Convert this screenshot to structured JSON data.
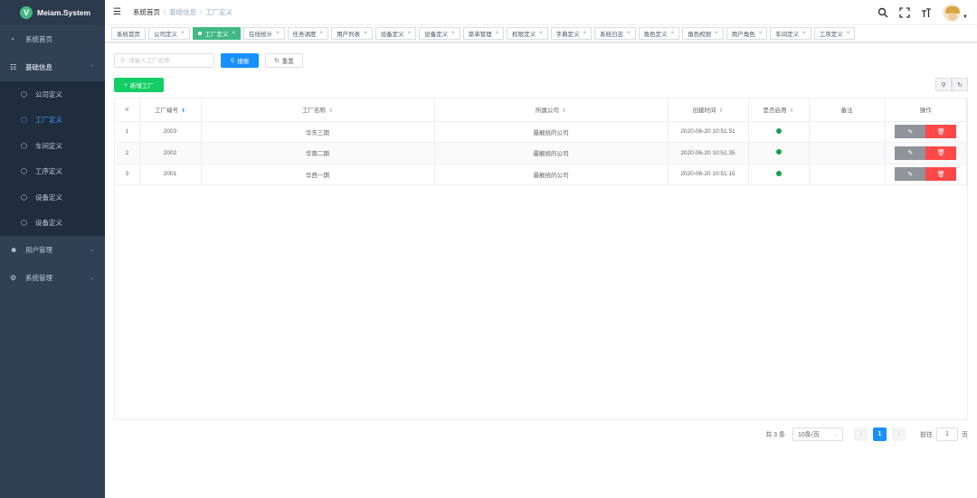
{
  "app": {
    "logo_letter": "V",
    "title": "Meiam.System"
  },
  "sidebar": {
    "items": [
      {
        "label": "系统首页",
        "icon": "dashboard-icon"
      },
      {
        "label": "基础信息",
        "icon": "sitemap-icon",
        "open": true
      },
      {
        "label": "用户管理",
        "icon": "user-group-icon"
      },
      {
        "label": "系统管理",
        "icon": "gear-icon"
      }
    ],
    "sub_items": [
      {
        "label": "公司定义"
      },
      {
        "label": "工厂定义",
        "active": true
      },
      {
        "label": "车间定义"
      },
      {
        "label": "工序定义"
      },
      {
        "label": "设备定义"
      },
      {
        "label": "设备定义"
      }
    ]
  },
  "breadcrumb": [
    "系统首页",
    "基础信息",
    "工厂定义"
  ],
  "tags": [
    {
      "label": "系统首页",
      "closable": false
    },
    {
      "label": "公司定义",
      "closable": true
    },
    {
      "label": "工厂定义",
      "closable": true,
      "active": true
    },
    {
      "label": "在线统计",
      "closable": true
    },
    {
      "label": "任务调度",
      "closable": true
    },
    {
      "label": "用户列表",
      "closable": true
    },
    {
      "label": "设备定义",
      "closable": true
    },
    {
      "label": "设备定义",
      "closable": true
    },
    {
      "label": "菜单管理",
      "closable": true
    },
    {
      "label": "权限定义",
      "closable": true
    },
    {
      "label": "字典定义",
      "closable": true
    },
    {
      "label": "系统日志",
      "closable": true
    },
    {
      "label": "角色定义",
      "closable": true
    },
    {
      "label": "角色权限",
      "closable": true
    },
    {
      "label": "用户角色",
      "closable": true
    },
    {
      "label": "车间定义",
      "closable": true
    },
    {
      "label": "工序定义",
      "closable": true
    }
  ],
  "search": {
    "placeholder": "请输入工厂名称",
    "search_label": "搜索",
    "reset_label": "重置"
  },
  "add_button": "新增工厂",
  "table": {
    "columns": [
      "#",
      "工厂编号",
      "工厂名称",
      "所属公司",
      "创建时间",
      "是否启用",
      "备注",
      "操作"
    ],
    "rows": [
      {
        "idx": "1",
        "code": "2003",
        "name": "华东三期",
        "company": "最靓统的公司",
        "created": "2020-06-20 10:51:51",
        "enabled": true,
        "remark": ""
      },
      {
        "idx": "2",
        "code": "2002",
        "name": "华南二期",
        "company": "最靓统的公司",
        "created": "2020-06-20 10:51:35",
        "enabled": true,
        "remark": ""
      },
      {
        "idx": "3",
        "code": "2001",
        "name": "华西一期",
        "company": "最靓统的公司",
        "created": "2020-06-20 10:51:15",
        "enabled": true,
        "remark": ""
      }
    ]
  },
  "pagination": {
    "total_text": "共 3 条",
    "page_size": "10条/页",
    "current_page": "1",
    "goto_label": "前往",
    "goto_value": "1",
    "page_suffix": "页"
  },
  "colors": {
    "sidebar_bg": "#304156",
    "active_tag": "#42b983",
    "primary": "#1890ff",
    "success": "#13ce66",
    "danger": "#ff4949"
  }
}
